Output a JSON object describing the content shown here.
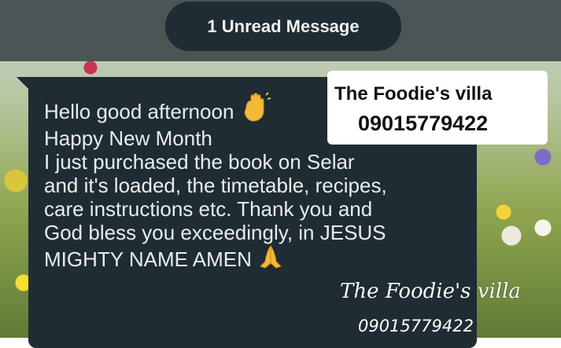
{
  "banner": {
    "unread_label": "1 Unread Message"
  },
  "message": {
    "lines": [
      "Hello good afternoon",
      "Happy New Month",
      "I just purchased the book on Selar",
      "and it's loaded, the timetable, recipes,",
      "care instructions etc. Thank you and",
      "God bless you exceedingly, in JESUS",
      "MIGHTY NAME AMEN"
    ],
    "emoji": {
      "wave": "waving-hand-icon",
      "pray": "praying-hands-icon"
    }
  },
  "watermark": {
    "name": "The Foodie's villa",
    "phone": "09015779422",
    "script_name": "The Foodie's villa",
    "script_phone": "09015779422"
  },
  "colors": {
    "bubble": "#1f2c33",
    "message_text": "#e9edef",
    "banner_band": "#4c5556"
  }
}
